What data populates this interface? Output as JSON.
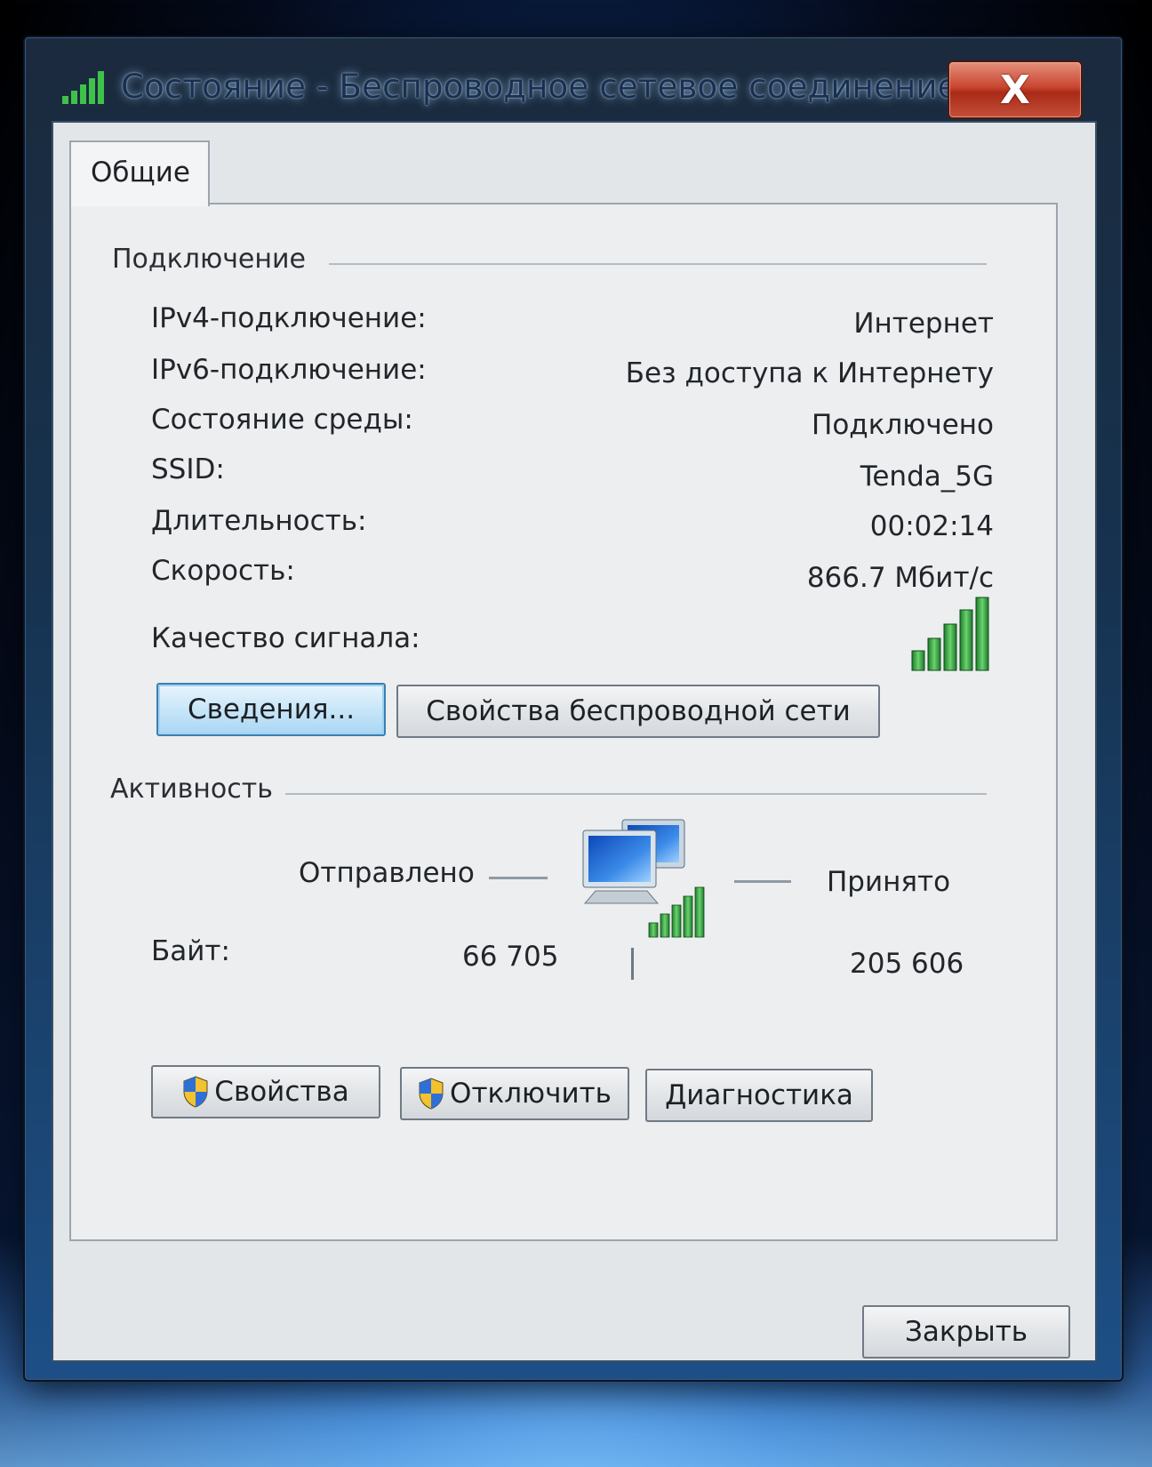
{
  "window": {
    "title": "Состояние - Беспроводное сетевое соединение",
    "close_glyph": "X"
  },
  "tabs": [
    {
      "label": "Общие"
    }
  ],
  "connection": {
    "group_title": "Подключение",
    "rows": [
      {
        "label": "IPv4-подключение:",
        "value": "Интернет"
      },
      {
        "label": "IPv6-подключение:",
        "value": "Без доступа к Интернету"
      },
      {
        "label": "Состояние среды:",
        "value": "Подключено"
      },
      {
        "label": "SSID:",
        "value": "Tenda_5G"
      },
      {
        "label": "Длительность:",
        "value": "00:02:14"
      },
      {
        "label": "Скорость:",
        "value": "866.7 Мбит/с"
      }
    ],
    "signal_label": "Качество сигнала:",
    "signal_bars": 5,
    "signal_icon": "signal-strength-icon",
    "details_button": "Сведения...",
    "wireless_props_button": "Свойства беспроводной сети"
  },
  "activity": {
    "group_title": "Активность",
    "sent_label": "Отправлено",
    "received_label": "Принято",
    "bytes_label": "Байт:",
    "bytes_sent": "66 705",
    "bytes_received": "205 606",
    "network_icon": "network-computer-icon"
  },
  "buttons": {
    "properties": "Свойства",
    "disable": "Отключить",
    "diagnose": "Диагностика",
    "close": "Закрыть"
  },
  "colors": {
    "signal_green": "#2e9a3a",
    "close_red": "#c94630",
    "focus_blue": "#3c7fb1"
  }
}
